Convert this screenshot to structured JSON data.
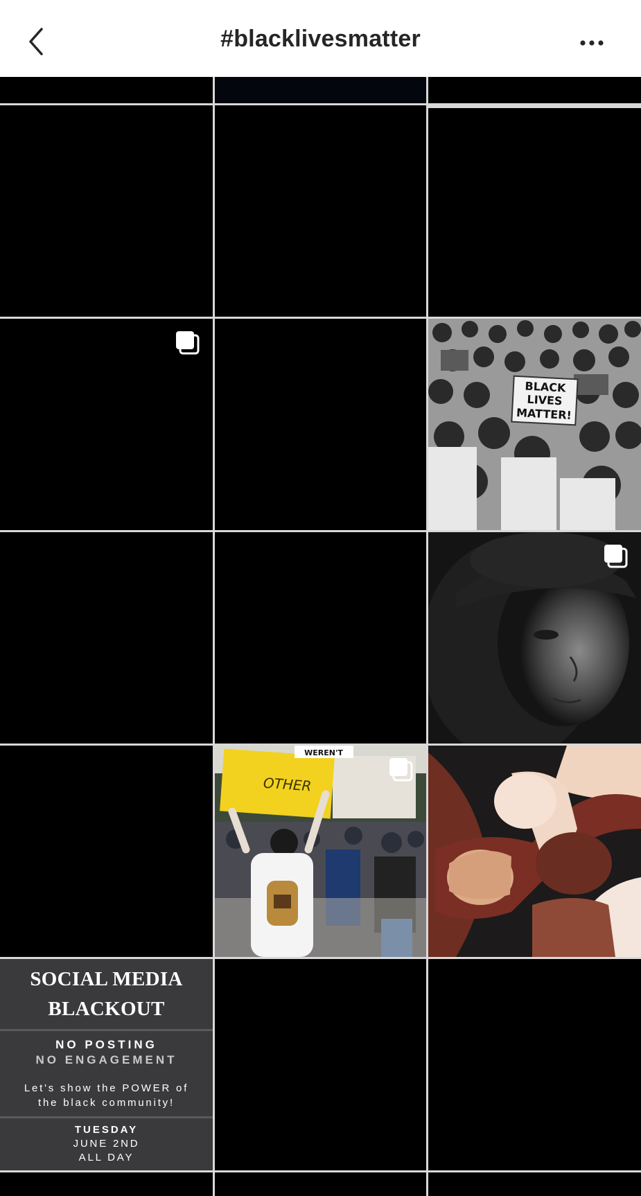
{
  "header": {
    "title": "#blacklivesmatter",
    "back_icon": "chevron-left-icon",
    "more_icon": "more-horizontal-icon"
  },
  "colors": {
    "header_bg": "#ffffff",
    "title_text": "#262626",
    "tile_black": "#000000",
    "grid_gap": "#d9d9d9"
  },
  "posts": {
    "crowd_sign": "BLACK LIVES MATTER!",
    "protest_sign_top": "WEREN'T",
    "protest_sign_main": "OTHER",
    "blackout": {
      "title_line1": "SOCIAL MEDIA",
      "title_line2": "BLACKOUT",
      "line1": "NO POSTING",
      "line2": "NO ENGAGEMENT",
      "message_line1": "Let's show the POWER of",
      "message_line2": "the black community!",
      "day": "TUESDAY",
      "date": "JUNE 2ND",
      "time": "ALL DAY"
    }
  }
}
